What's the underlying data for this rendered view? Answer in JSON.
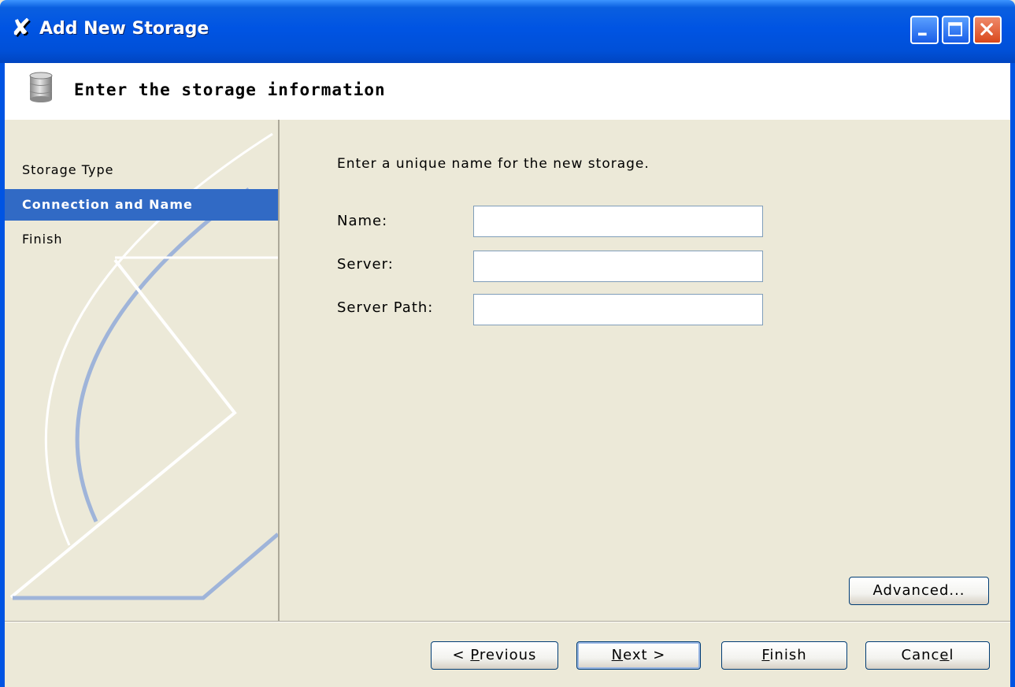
{
  "window": {
    "title": "Add New Storage"
  },
  "header": {
    "title": "Enter the storage information",
    "icon": "database-icon"
  },
  "steps": [
    {
      "label": "Storage Type",
      "active": false
    },
    {
      "label": "Connection and Name",
      "active": true
    },
    {
      "label": "Finish",
      "active": false
    }
  ],
  "content": {
    "instruction": "Enter a unique name for the new storage.",
    "fields": {
      "name": {
        "label": "Name:",
        "value": ""
      },
      "server": {
        "label": "Server:",
        "value": ""
      },
      "server_path": {
        "label": "Server Path:",
        "value": ""
      }
    },
    "advanced_label": "Advanced..."
  },
  "footer": {
    "previous_prefix": "< ",
    "previous_mnemonic": "P",
    "previous_rest": "revious",
    "next_mnemonic": "N",
    "next_rest": "ext >",
    "finish_mnemonic": "F",
    "finish_rest": "inish",
    "cancel_pre": "Canc",
    "cancel_mnemonic": "e",
    "cancel_rest": "l"
  },
  "colors": {
    "titlebar": "#0054e3",
    "selected_step": "#316ac5",
    "dialog_bg": "#ece9d8",
    "close_button": "#d9481c"
  }
}
